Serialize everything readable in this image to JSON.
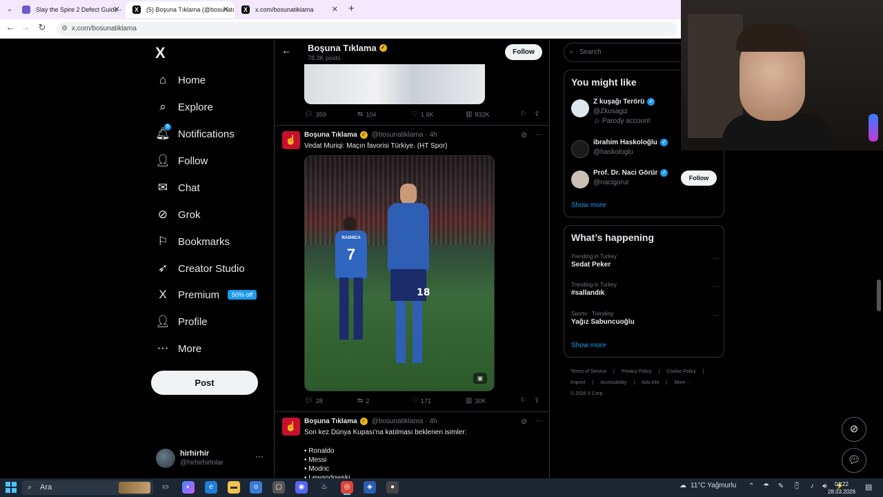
{
  "browser": {
    "tabs": [
      {
        "title": "Slay the Spire 2 Defect Guide -",
        "active": false
      },
      {
        "title": "(5) Boşuna Tıklama (@bosunatı",
        "active": true
      },
      {
        "title": "x.com/bosunatiklama",
        "active": false
      }
    ],
    "url": "x.com/bosunatiklama"
  },
  "sidebar": {
    "logo": "X",
    "items": [
      {
        "label": "Home",
        "icon": "home-icon",
        "glyph": "⌂"
      },
      {
        "label": "Explore",
        "icon": "search-icon",
        "glyph": "⌕"
      },
      {
        "label": "Notifications",
        "icon": "bell-icon",
        "glyph": "🔔︎",
        "badge": "5"
      },
      {
        "label": "Follow",
        "icon": "person-add-icon",
        "glyph": "👤︎"
      },
      {
        "label": "Chat",
        "icon": "mail-icon",
        "glyph": "✉"
      },
      {
        "label": "Grok",
        "icon": "grok-icon",
        "glyph": "⊘"
      },
      {
        "label": "Bookmarks",
        "icon": "bookmark-icon",
        "glyph": "⚐"
      },
      {
        "label": "Creator Studio",
        "icon": "rocket-icon",
        "glyph": "➶"
      },
      {
        "label": "Premium",
        "icon": "x-logo-icon",
        "glyph": "X",
        "promo": "50% off"
      },
      {
        "label": "Profile",
        "icon": "person-icon",
        "glyph": "👤︎"
      },
      {
        "label": "More",
        "icon": "more-circle-icon",
        "glyph": "⋯"
      }
    ],
    "post_label": "Post",
    "account": {
      "name": "hirhirhir",
      "handle": "@hirhirhirtolar"
    }
  },
  "profile_header": {
    "name": "Boşuna Tıklama",
    "posts": "78.3K posts",
    "follow_label": "Follow"
  },
  "feed": {
    "first_tweet_actions": {
      "replies": "359",
      "reposts": "104",
      "likes": "1.6K",
      "views": "832K"
    },
    "tweet2": {
      "name": "Boşuna Tıklama",
      "handle": "@bosunatiklama",
      "time": "· 4h",
      "text": "Vedat Muriqi: Maçın favorisi Türkiye. (HT Spor)",
      "jersey_back_name": "RASHICA",
      "jersey_back_number": "7",
      "jersey_front_number": "18",
      "actions": {
        "replies": "28",
        "reposts": "2",
        "likes": "171",
        "views": "30K"
      }
    },
    "tweet3": {
      "name": "Boşuna Tıklama",
      "handle": "@bosunatiklama",
      "time": "· 4h",
      "text": "Son kez Dünya Kupası'na katılması beklenen isimler:",
      "list": [
        "• Ronaldo",
        "• Messi",
        "• Modric",
        "• Lewandowski"
      ]
    }
  },
  "right": {
    "search_placeholder": "Search",
    "might_like": {
      "title": "You might like",
      "users": [
        {
          "name": "Z kuşağı Terörü",
          "handle": "@Zkusagiz",
          "sub": "Parody account",
          "avatar_color": "#dfe6ee"
        },
        {
          "name": "ibrahim Haskoloğlu",
          "handle": "@haskologlu",
          "sub": "",
          "avatar_color": "#1a1a1a",
          "follow": "Follow"
        },
        {
          "name": "Prof. Dr. Naci Görür",
          "handle": "@nacigorur",
          "sub": "",
          "avatar_color": "#c9bfb5",
          "follow": "Follow"
        }
      ],
      "show_more": "Show more"
    },
    "happening": {
      "title": "What’s happening",
      "trends": [
        {
          "context": "Trending in Turkey",
          "title": "Sedat Peker"
        },
        {
          "context": "Trending in Turkey",
          "title": "#sallandık"
        },
        {
          "context": "Sports · Trending",
          "title": "Yağız Sabuncuoğlu"
        }
      ],
      "show_more": "Show more"
    },
    "footer": [
      "Terms of Service",
      "|",
      "Privacy Policy",
      "|",
      "Cookie Policy",
      "|",
      "Imprint",
      "|",
      "Accessibility",
      "|",
      "Ads info",
      "|",
      "More ···",
      "© 2026 X Corp."
    ]
  },
  "taskbar": {
    "search_label": "Ara",
    "weather": "11°C  Yağmurlu",
    "time": "04:22",
    "date": "28.03.2026"
  }
}
